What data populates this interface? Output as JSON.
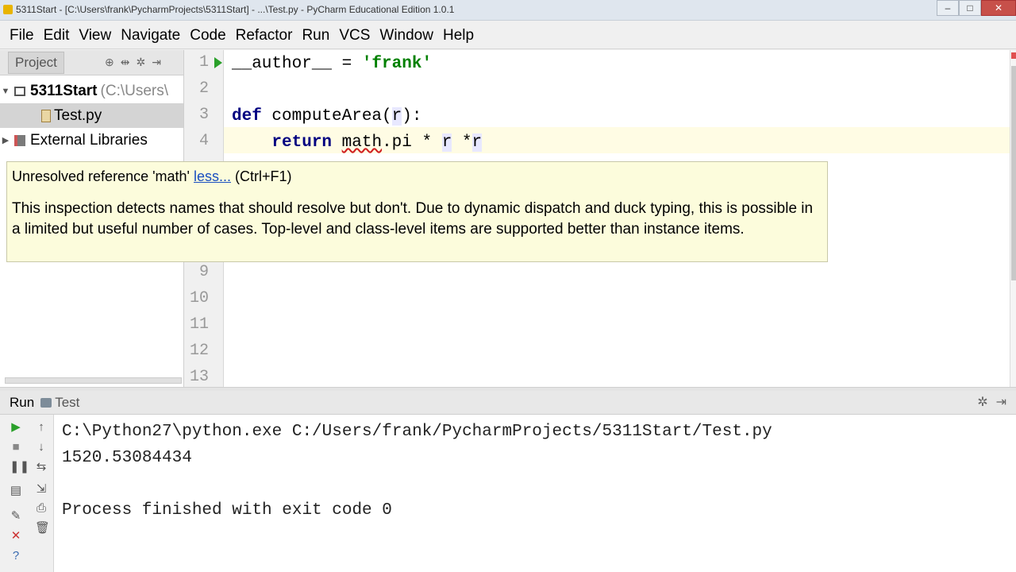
{
  "window": {
    "title": "5311Start - [C:\\Users\\frank\\PycharmProjects\\5311Start] - ...\\Test.py - PyCharm Educational Edition 1.0.1",
    "minimize": "–",
    "maximize": "□",
    "close": "✕"
  },
  "menu": [
    "File",
    "Edit",
    "View",
    "Navigate",
    "Code",
    "Refactor",
    "Run",
    "VCS",
    "Window",
    "Help"
  ],
  "project_panel": {
    "tab_label": "Project",
    "root_name": "5311Start",
    "root_path": "(C:\\Users\\",
    "file_name": "Test.py",
    "libraries": "External Libraries"
  },
  "editor": {
    "line_numbers": [
      "1",
      "2",
      "3",
      "4",
      "9",
      "10",
      "11",
      "12",
      "13"
    ],
    "line1_pre": "__author__ = ",
    "line1_str": "'frank'",
    "line3_kw": "def",
    "line3_rest": " computeArea(",
    "line3_param": "r",
    "line3_end": "):",
    "line4_kw": "return",
    "line4_math": "math",
    "line4_mid": ".pi * ",
    "line4_r1": "r",
    "line4_mid2": " *",
    "line4_r2": "r"
  },
  "tooltip": {
    "message": "Unresolved reference 'math'",
    "link": "less...",
    "shortcut": "(Ctrl+F1)",
    "body": "This inspection detects names that should resolve but don't. Due to dynamic dispatch and duck typing, this is possible in a limited but useful number of cases. Top-level and class-level items are supported better than instance items."
  },
  "run_panel": {
    "label": "Run",
    "tab": "Test",
    "console": [
      "C:\\Python27\\python.exe C:/Users/frank/PycharmProjects/5311Start/Test.py",
      "1520.53084434",
      "",
      "Process finished with exit code 0"
    ]
  },
  "colors": {
    "keyword": "#000080",
    "string": "#008000",
    "tooltip_bg": "#fcfcdc",
    "current_line": "#fffce4"
  }
}
